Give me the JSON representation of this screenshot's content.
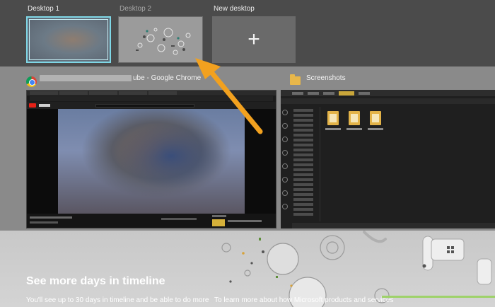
{
  "desktops": [
    {
      "label": "Desktop 1"
    },
    {
      "label": "Desktop 2"
    },
    {
      "label": "New desktop",
      "icon": "plus-icon",
      "glyph": "+"
    }
  ],
  "windows": {
    "chrome": {
      "title": "ube - Google Chrome",
      "icon": "chrome-icon"
    },
    "explorer": {
      "title": "Screenshots",
      "icon": "folder-icon"
    }
  },
  "timeline": {
    "heading": "See more days in timeline",
    "body": "You'll see up to 30 days in timeline and be able to do more",
    "learn_more": "To learn more about how Microsoft products and services"
  },
  "colors": {
    "selected_outline": "#7fd7e6",
    "arrow": "#f2a11f",
    "accent_line": "#9ed26a"
  }
}
